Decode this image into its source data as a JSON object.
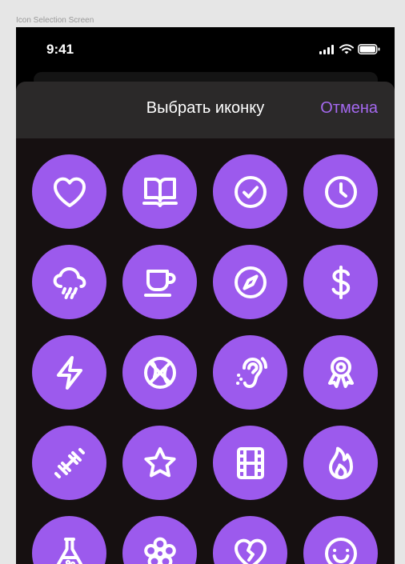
{
  "frame": {
    "label": "Icon Selection Screen"
  },
  "status_bar": {
    "time": "9:41"
  },
  "sheet": {
    "title": "Выбрать иконку",
    "cancel_label": "Отмена"
  },
  "colors": {
    "accent": "#9c5aed",
    "cancel": "#a569f0",
    "header_bg": "#2b2929",
    "sheet_bg": "#161011"
  },
  "icons": [
    "heart-icon",
    "book-icon",
    "check-circle-icon",
    "clock-icon",
    "cloud-rain-icon",
    "coffee-cup-icon",
    "compass-icon",
    "dollar-icon",
    "lightning-icon",
    "basketball-icon",
    "ear-icon",
    "award-ribbon-icon",
    "dumbbell-icon",
    "star-icon",
    "film-icon",
    "flame-icon",
    "flask-icon",
    "flower-icon",
    "broken-heart-icon",
    "smile-icon"
  ]
}
